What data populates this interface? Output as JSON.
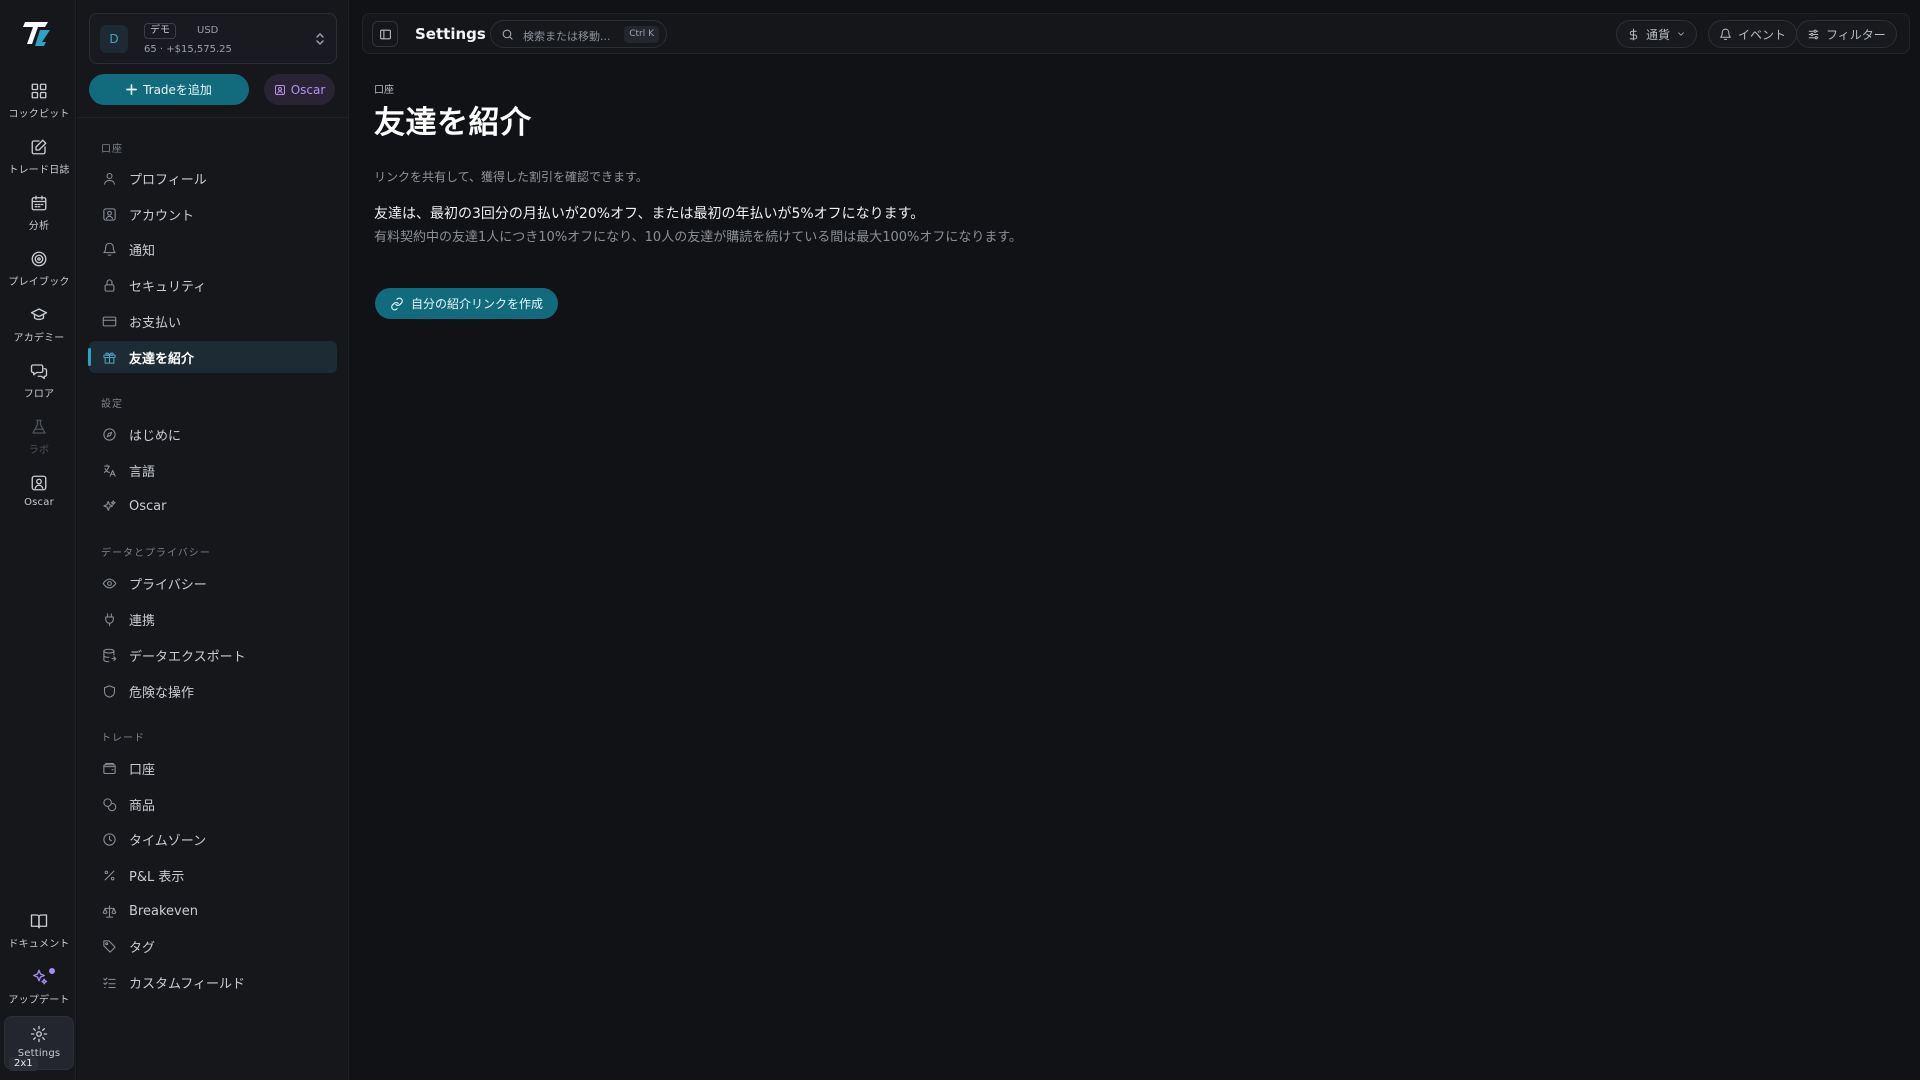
{
  "rail": {
    "items": [
      {
        "label": "コックピット",
        "icon": "dashboard-icon"
      },
      {
        "label": "トレード日誌",
        "icon": "journal-icon"
      },
      {
        "label": "分析",
        "icon": "calendar-icon"
      },
      {
        "label": "プレイブック",
        "icon": "target-icon"
      },
      {
        "label": "アカデミー",
        "icon": "graduation-cap-icon"
      },
      {
        "label": "フロア",
        "icon": "chat-icon"
      },
      {
        "label": "ラボ",
        "icon": "flask-icon"
      },
      {
        "label": "Oscar",
        "icon": "user-square-icon"
      }
    ],
    "bottom": [
      {
        "label": "ドキュメント",
        "icon": "book-icon"
      },
      {
        "label": "アップデート",
        "icon": "sparkles-icon"
      },
      {
        "label": "Settings",
        "icon": "gear-icon"
      }
    ],
    "zoom_badge": "2x1"
  },
  "account": {
    "avatar": "D",
    "tag": "デモ",
    "currency": "USD",
    "balance": "65 · +$15,575.25"
  },
  "actions": {
    "add_trade": "Tradeを追加",
    "oscar": "Oscar"
  },
  "sidebar": {
    "sections": [
      {
        "label": "口座",
        "items": [
          "プロフィール",
          "アカウント",
          "通知",
          "セキュリティ",
          "お支払い",
          "友達を紹介"
        ]
      },
      {
        "label": "設定",
        "items": [
          "はじめに",
          "言語",
          "Oscar"
        ]
      },
      {
        "label": "データとプライバシー",
        "items": [
          "プライバシー",
          "連携",
          "データエクスポート",
          "危険な操作"
        ]
      },
      {
        "label": "トレード",
        "items": [
          "口座",
          "商品",
          "タイムゾーン",
          "P&L 表示",
          "Breakeven",
          "タグ",
          "カスタムフィールド"
        ]
      }
    ],
    "active_item": "友達を紹介"
  },
  "topbar": {
    "title": "Settings",
    "search_placeholder": "検索または移動...",
    "shortcut": "Ctrl K",
    "currency": "通貨",
    "events": "イベント",
    "filter": "フィルター"
  },
  "content": {
    "breadcrumb": "口座",
    "title": "友達を紹介",
    "description": "リンクを共有して、獲得した割引を確認できます。",
    "lead": "友達は、最初の3回分の月払いが20%オフ、または最初の年払いが5%オフになります。",
    "sub": "有料契約中の友達1人につき10%オフになり、10人の友達が購読を続けている間は最大100%オフになります。",
    "cta": "自分の紹介リンクを作成"
  },
  "colors": {
    "accent": "#116b7d",
    "oscar": "#b392f0",
    "background": "#111215"
  }
}
